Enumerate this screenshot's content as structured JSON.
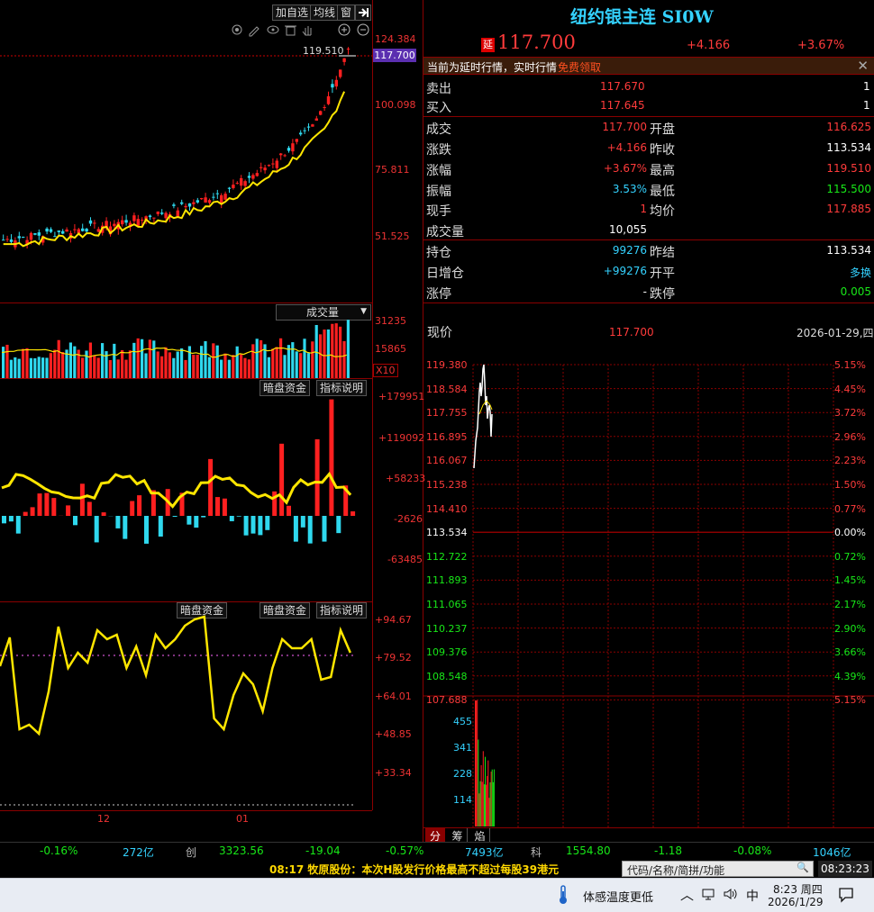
{
  "toolbar": {
    "add_watch": "加自选",
    "ma_line": "均线",
    "window": "窗"
  },
  "kline": {
    "axis": [
      "124.384",
      "100.098",
      "75.811",
      "51.525"
    ],
    "cursor_high": "119.510",
    "price_tag": "117.700"
  },
  "volume": {
    "selector": "成交量",
    "axis": [
      "31235",
      "15865"
    ],
    "scale": "X10"
  },
  "darkflow": {
    "btn1": "暗盘资金",
    "btn2": "指标说明",
    "axis": [
      "+179951",
      "+119092",
      "+58233",
      "-2626",
      "-63485"
    ]
  },
  "indicator": {
    "btn0": "暗盘资金",
    "btn1": "暗盘资金",
    "btn2": "指标说明",
    "axis": [
      "+94.67",
      "+79.52",
      "+64.01",
      "+48.85",
      "+33.34"
    ]
  },
  "xaxis": {
    "dec": "12",
    "jan": "01"
  },
  "quote": {
    "title": "纽约银主连 SI0W",
    "delay_badge": "延",
    "price": "117.700",
    "change": "+4.166",
    "pct": "+3.67%",
    "notice": "当前为延时行情，实时行情",
    "notice_link": "免费领取",
    "sell_label": "卖出",
    "sell_price": "117.670",
    "sell_qty": "1",
    "buy_label": "买入",
    "buy_price": "117.645",
    "buy_qty": "1",
    "rows": [
      {
        "l1": "成交",
        "v1": "117.700",
        "l2": "开盘",
        "v2": "116.625"
      },
      {
        "l1": "涨跌",
        "v1": "+4.166",
        "l2": "昨收",
        "v2": "113.534"
      },
      {
        "l1": "涨幅",
        "v1": "+3.67%",
        "l2": "最高",
        "v2": "119.510"
      },
      {
        "l1": "振幅",
        "v1": "3.53%",
        "l2": "最低",
        "v2": "115.500"
      },
      {
        "l1": "现手",
        "v1": "1",
        "l2": "均价",
        "v2": "117.885"
      },
      {
        "l1": "成交量",
        "v1": "10,055",
        "l2": "",
        "v2": ""
      },
      {
        "l1": "持仓",
        "v1": "99276",
        "l2": "昨结",
        "v2": "113.534"
      },
      {
        "l1": "日增仓",
        "v1": "+99276",
        "l2": "开平",
        "v2": "多换"
      },
      {
        "l1": "涨停",
        "v1": "-",
        "l2": "跌停",
        "v2": "0.005"
      }
    ]
  },
  "intraday": {
    "label": "现价",
    "price": "117.700",
    "date": "2026-01-29,四",
    "left_axis": [
      "119.380",
      "118.584",
      "117.755",
      "116.895",
      "116.067",
      "115.238",
      "114.410",
      "113.534",
      "112.722",
      "111.893",
      "111.065",
      "110.237",
      "109.376",
      "108.548",
      "107.688"
    ],
    "right_axis": [
      "5.15%",
      "4.45%",
      "3.72%",
      "2.96%",
      "2.23%",
      "1.50%",
      "0.77%",
      "0.00%",
      "0.72%",
      "1.45%",
      "2.17%",
      "2.90%",
      "3.66%",
      "4.39%",
      "5.15%"
    ],
    "vol_axis": [
      "455",
      "341",
      "228",
      "114"
    ],
    "tabs": [
      "分",
      "筹",
      "焰"
    ]
  },
  "status": {
    "a": "-0.16%",
    "b": "272亿",
    "c": "创",
    "d": "3323.56",
    "e": "-19.04",
    "f": "-0.57%",
    "g": "7493亿",
    "h": "科",
    "i": "1554.80",
    "j": "-1.18",
    "k": "-0.08%",
    "l": "1046亿"
  },
  "ticker": {
    "text": "08:17 牧原股份：本次H股发行价格最高不超过每股39港元",
    "search_placeholder": "代码/名称/简拼/功能",
    "clock": "08:23:23"
  },
  "taskbar": {
    "weather": "体感温度更低",
    "ime": "中",
    "time": "8:23 周四",
    "date": "2026/1/29"
  },
  "colors": {
    "up": "#ff2020",
    "down": "#2fd8ee",
    "ma": "#ffe600",
    "grid": "#8a0000"
  }
}
